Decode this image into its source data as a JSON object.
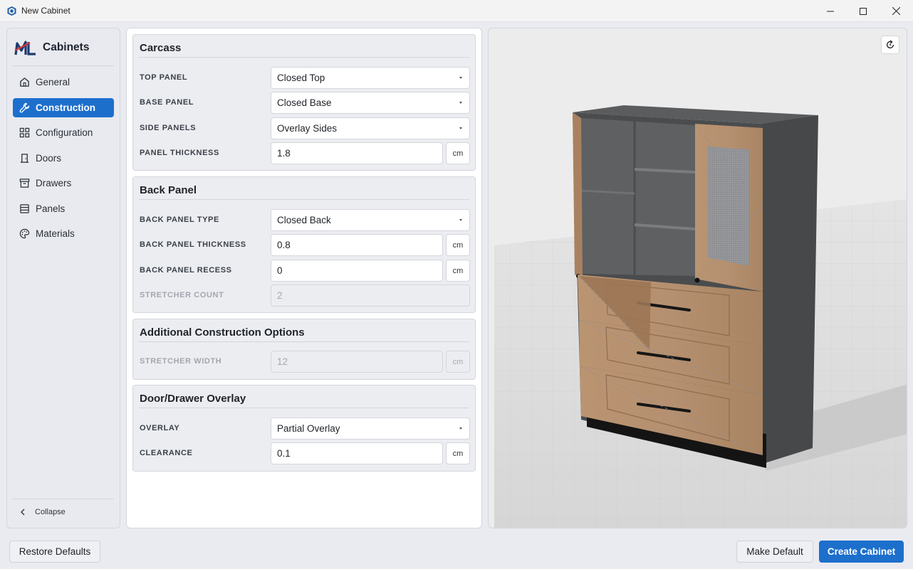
{
  "window": {
    "title": "New Cabinet",
    "app_icon": "sketchup-icon"
  },
  "window_controls": [
    "minimize-icon",
    "maximize-icon",
    "close-icon"
  ],
  "sidebar": {
    "brand": "Cabinets",
    "items": [
      {
        "label": "General",
        "icon": "home-icon",
        "active": false
      },
      {
        "label": "Construction",
        "icon": "wrench-icon",
        "active": true
      },
      {
        "label": "Configuration",
        "icon": "grid-icon",
        "active": false
      },
      {
        "label": "Doors",
        "icon": "door-icon",
        "active": false
      },
      {
        "label": "Drawers",
        "icon": "archive-icon",
        "active": false
      },
      {
        "label": "Panels",
        "icon": "panels-icon",
        "active": false
      },
      {
        "label": "Materials",
        "icon": "palette-icon",
        "active": false
      }
    ],
    "collapse_label": "Collapse"
  },
  "sections": {
    "carcass": {
      "title": "Carcass",
      "top_panel": {
        "label": "TOP PANEL",
        "value": "Closed Top"
      },
      "base_panel": {
        "label": "BASE PANEL",
        "value": "Closed Base"
      },
      "side_panels": {
        "label": "SIDE PANELS",
        "value": "Overlay Sides"
      },
      "panel_thickness": {
        "label": "PANEL THICKNESS",
        "value": "1.8",
        "unit": "cm"
      }
    },
    "back_panel": {
      "title": "Back Panel",
      "type": {
        "label": "BACK PANEL TYPE",
        "value": "Closed Back"
      },
      "thickness": {
        "label": "BACK PANEL THICKNESS",
        "value": "0.8",
        "unit": "cm"
      },
      "recess": {
        "label": "BACK PANEL RECESS",
        "value": "0",
        "unit": "cm"
      },
      "stretcher_count": {
        "label": "STRETCHER COUNT",
        "value": "2"
      }
    },
    "additional": {
      "title": "Additional Construction Options",
      "stretcher_width": {
        "label": "STRETCHER WIDTH",
        "value": "12",
        "unit": "cm"
      }
    },
    "overlay": {
      "title": "Door/Drawer Overlay",
      "overlay": {
        "label": "OVERLAY",
        "value": "Partial Overlay"
      },
      "clearance": {
        "label": "CLEARANCE",
        "value": "0.1",
        "unit": "cm"
      }
    }
  },
  "preview": {
    "reset_icon": "refresh-icon"
  },
  "footer": {
    "restore_defaults": "Restore Defaults",
    "make_default": "Make Default",
    "create_cabinet": "Create Cabinet"
  },
  "colors": {
    "accent": "#1d6fcc",
    "wood": "#b08c6a",
    "carcass": "#4a4c4e"
  }
}
